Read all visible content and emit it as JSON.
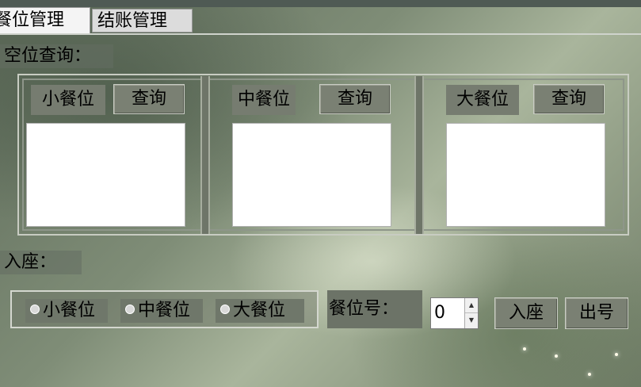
{
  "tabs": {
    "dining": "餐位管理",
    "checkout": "结账管理"
  },
  "query_section": {
    "title": "空位查询：",
    "groups": [
      {
        "label": "小餐位",
        "button": "查询"
      },
      {
        "label": "中餐位",
        "button": "查询"
      },
      {
        "label": "大餐位",
        "button": "查询"
      }
    ]
  },
  "seat_section": {
    "title": "入座：",
    "radios": [
      "小餐位",
      "中餐位",
      "大餐位"
    ],
    "number_label": "餐位号：",
    "number_value": "0",
    "seat_button": "入座",
    "exit_button": "出号"
  },
  "icons": {
    "spinner_up": "up-arrow-icon",
    "spinner_down": "down-arrow-icon"
  }
}
